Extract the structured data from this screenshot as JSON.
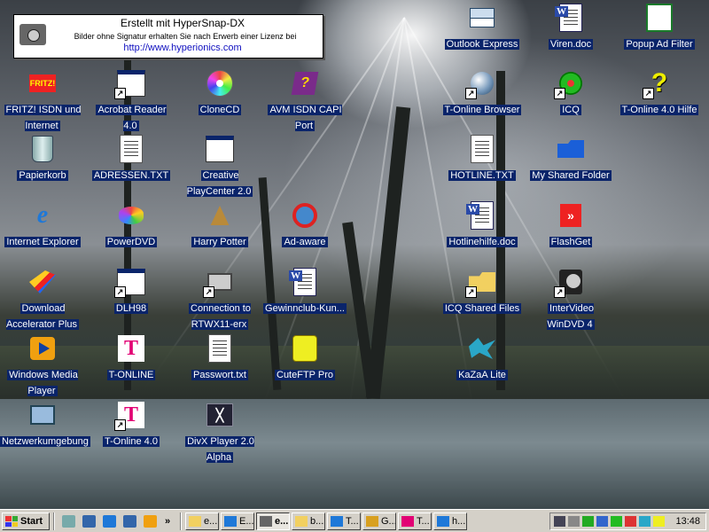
{
  "stamp": {
    "title": "Erstellt mit HyperSnap-DX",
    "subtitle": "Bilder ohne Signatur erhalten Sie nach Erwerb einer Lizenz bei",
    "url": "http://www.hyperionics.com"
  },
  "icons": [
    {
      "label": "FRITZ! ISDN und Internet",
      "icon": "fritz-icon",
      "shortcut": false
    },
    {
      "label": "Acrobat Reader 4.0",
      "icon": "program-window-icon",
      "shortcut": true
    },
    {
      "label": "CloneCD",
      "icon": "cd-icon",
      "shortcut": false
    },
    {
      "label": "AVM ISDN CAPI Port",
      "icon": "capi-book-icon",
      "shortcut": false
    },
    {
      "label": "Outlook Express",
      "icon": "outlook-express-icon",
      "shortcut": false
    },
    {
      "label": "Viren.doc",
      "icon": "word-doc-icon",
      "shortcut": false
    },
    {
      "label": "Popup Ad Filter",
      "icon": "popup-filter-icon",
      "shortcut": false
    },
    {
      "label": "Papierkorb",
      "icon": "recycle-bin-icon",
      "shortcut": false
    },
    {
      "label": "ADRESSEN.TXT",
      "icon": "text-file-icon",
      "shortcut": false
    },
    {
      "label": "Creative PlayCenter 2.0",
      "icon": "program-window-icon",
      "shortcut": false
    },
    {
      "label": "T-Online Browser",
      "icon": "t-online-browser-icon",
      "shortcut": true
    },
    {
      "label": "ICQ",
      "icon": "icq-flower-icon",
      "shortcut": true
    },
    {
      "label": "T-Online 4.0 Hilfe",
      "icon": "help-icon",
      "shortcut": true
    },
    {
      "label": "Internet Explorer",
      "icon": "internet-explorer-icon",
      "shortcut": false
    },
    {
      "label": "PowerDVD",
      "icon": "powerdvd-icon",
      "shortcut": false
    },
    {
      "label": "Harry Potter",
      "icon": "harry-potter-icon",
      "shortcut": false
    },
    {
      "label": "Ad-aware",
      "icon": "ad-aware-icon",
      "shortcut": false
    },
    {
      "label": "HOTLINE.TXT",
      "icon": "text-file-icon",
      "shortcut": false
    },
    {
      "label": "My Shared Folder",
      "icon": "shared-folder-icon",
      "shortcut": false
    },
    {
      "label": "Download Accelerator Plus",
      "icon": "download-accelerator-icon",
      "shortcut": false
    },
    {
      "label": "DLH98",
      "icon": "program-window-icon",
      "shortcut": true
    },
    {
      "label": "Connection to RTWX11-erx",
      "icon": "network-connection-icon",
      "shortcut": true
    },
    {
      "label": "Gewinnclub-Kun...",
      "icon": "word-doc-icon",
      "shortcut": false
    },
    {
      "label": "Hotlinehilfe.doc",
      "icon": "word-doc-icon",
      "shortcut": false
    },
    {
      "label": "FlashGet",
      "icon": "flashget-icon",
      "shortcut": false
    },
    {
      "label": "Windows Media Player",
      "icon": "media-player-icon",
      "shortcut": false
    },
    {
      "label": "T-ONLINE",
      "icon": "t-online-icon",
      "shortcut": false
    },
    {
      "label": "Passwort.txt",
      "icon": "text-file-icon",
      "shortcut": false
    },
    {
      "label": "CuteFTP Pro",
      "icon": "cuteftp-icon",
      "shortcut": false
    },
    {
      "label": "ICQ Shared Files",
      "icon": "icq-folder-icon",
      "shortcut": true
    },
    {
      "label": "InterVideo WinDVD 4",
      "icon": "windvd-icon",
      "shortcut": true
    },
    {
      "label": "KaZaA Lite",
      "icon": "kazaa-icon",
      "shortcut": false
    },
    {
      "label": "Netzwerkumgebung",
      "icon": "network-neighborhood-icon",
      "shortcut": false
    },
    {
      "label": "T-Online 4.0",
      "icon": "t-online-icon",
      "shortcut": true
    },
    {
      "label": "DivX Player 2.0 Alpha",
      "icon": "divx-icon",
      "shortcut": false
    }
  ],
  "taskbar": {
    "start_label": "Start",
    "quicklaunch": [
      "show-desktop-icon",
      "outlook-express-icon",
      "internet-explorer-icon",
      "outlook-express-icon",
      "media-player-icon"
    ],
    "overflow": "»",
    "buttons": [
      {
        "label": "e...",
        "icon": "folder-icon",
        "active": false
      },
      {
        "label": "E...",
        "icon": "internet-explorer-icon",
        "active": false
      },
      {
        "label": "e...",
        "icon": "paint-icon",
        "active": true
      },
      {
        "label": "b...",
        "icon": "folder-icon",
        "active": false
      },
      {
        "label": "T...",
        "icon": "internet-explorer-icon",
        "active": false
      },
      {
        "label": "G...",
        "icon": "messenger-icon",
        "active": false
      },
      {
        "label": "T...",
        "icon": "t-online-icon",
        "active": false
      },
      {
        "label": "h...",
        "icon": "internet-explorer-icon",
        "active": false
      }
    ],
    "tray": [
      "monitor-icon",
      "volume-icon",
      "network-icon",
      "display-icon",
      "icq-icon",
      "shield-icon",
      "kazaa-tray-icon",
      "cuteftp-tray-icon"
    ],
    "clock": "13:48"
  },
  "colors": {
    "selection_label_bg": "#0a246a",
    "taskbar_bg": "#d4d0c8",
    "t_online_magenta": "#e20074",
    "hyperionics_link": "#1010c0"
  }
}
